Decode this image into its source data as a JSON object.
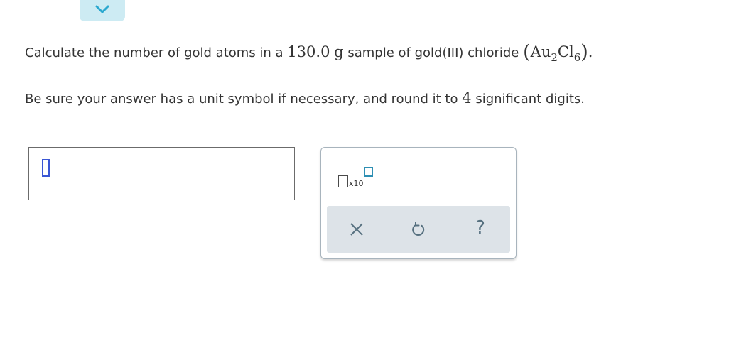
{
  "question": {
    "text_before": "Calculate the number of gold atoms in a ",
    "mass_value": "130.0",
    "mass_unit": "g",
    "text_middle": " sample of gold",
    "oxidation_state": "(III)",
    "text_after": " chloride ",
    "formula": {
      "open_paren": "(",
      "element1": "Au",
      "subscript1": "2",
      "element2": "Cl",
      "subscript2": "6",
      "close_paren": ")"
    },
    "end_punct": "."
  },
  "instruction": {
    "text_before": "Be sure your answer has a unit symbol if necessary, and round it to ",
    "digits": "4",
    "text_after": " significant digits."
  },
  "toolbar": {
    "sci_notation_label": "x10",
    "clear_icon": "close-icon",
    "undo_icon": "undo-icon",
    "help_label": "?"
  },
  "colors": {
    "collapse_bg": "#cdebf3",
    "chevron": "#2aa8cf",
    "cursor": "#3a56d4",
    "exponent_box": "#2e8fb3",
    "action_bar_bg": "#dde3e8",
    "action_icon": "#56707f"
  }
}
